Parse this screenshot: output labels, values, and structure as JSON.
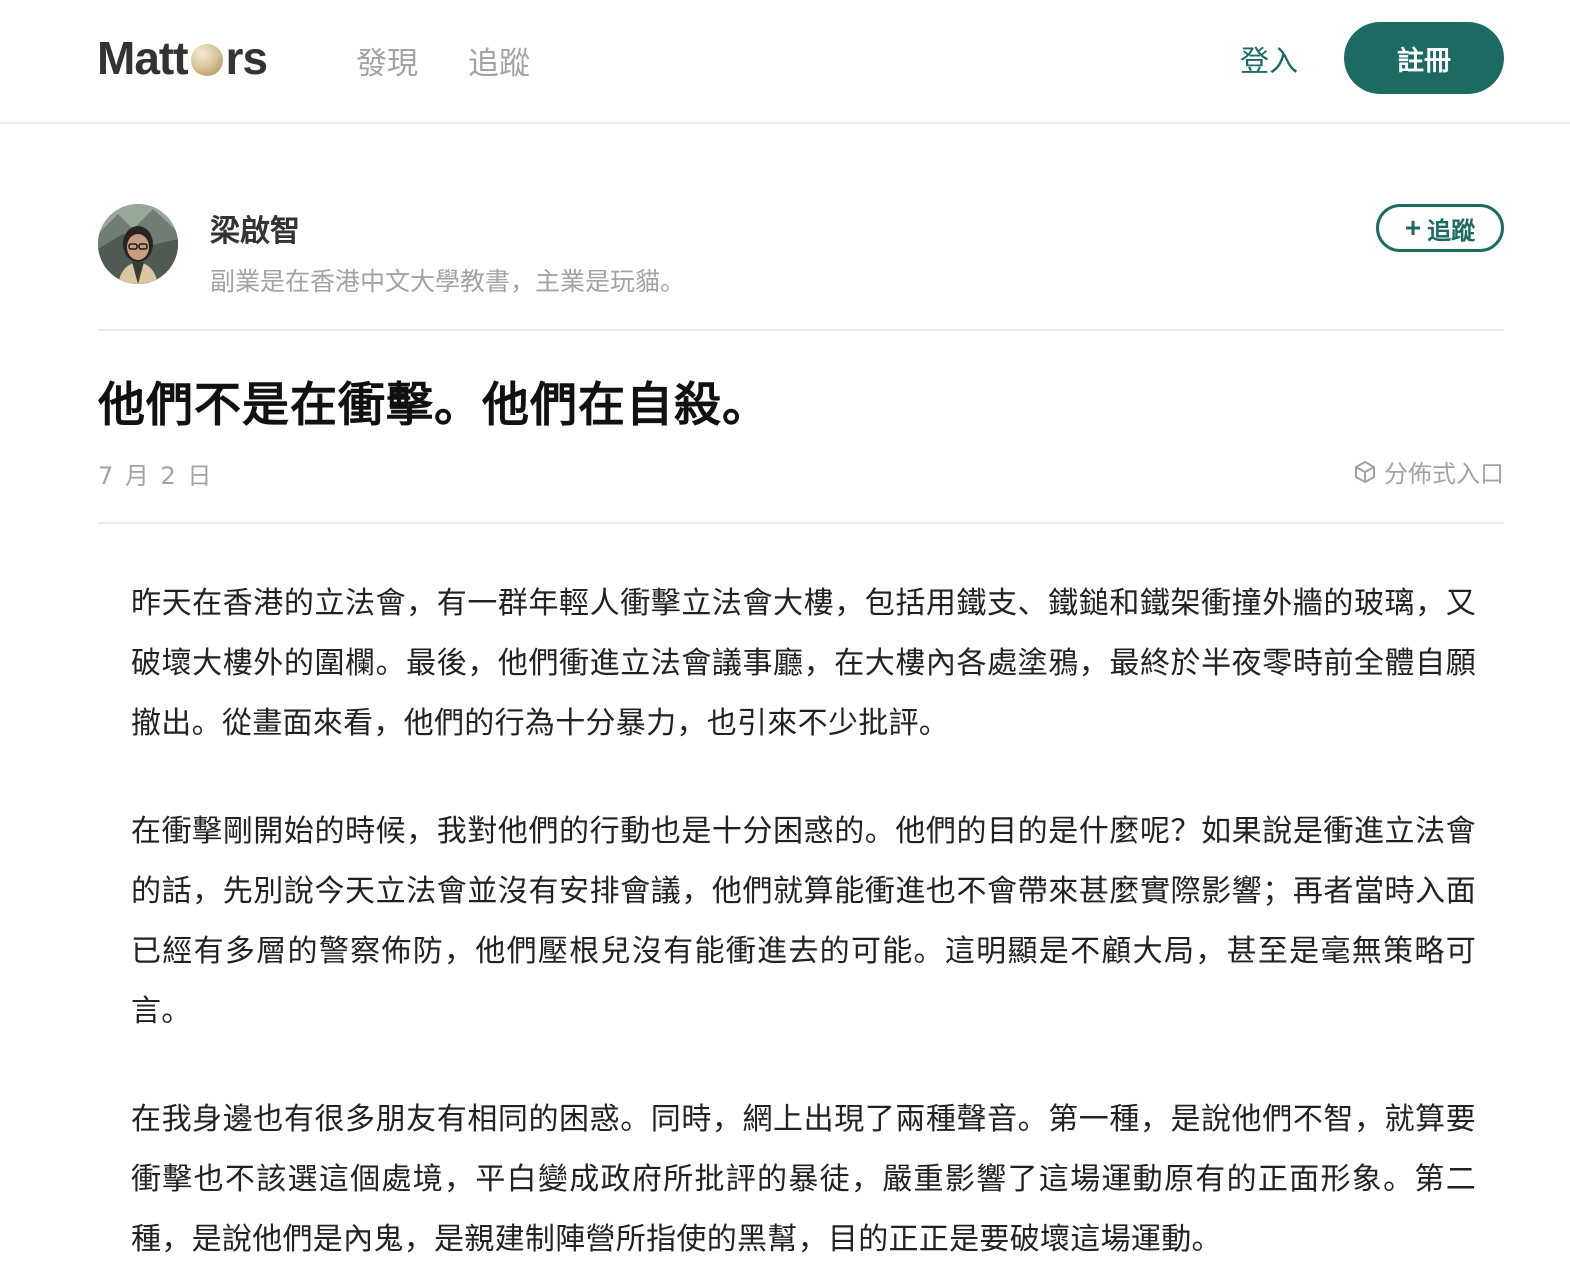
{
  "header": {
    "logo_text": "Matt rs",
    "logo_prefix": "Matt",
    "logo_suffix": "rs",
    "nav": [
      {
        "label": "發現"
      },
      {
        "label": "追蹤"
      }
    ],
    "login_label": "登入",
    "signup_label": "註冊"
  },
  "author": {
    "name": "梁啟智",
    "bio": "副業是在香港中文大學教書，主業是玩貓。",
    "follow_label": "追蹤",
    "follow_icon": "plus-icon"
  },
  "article": {
    "title": "他們不是在衝擊。他們在自殺。",
    "date": "7 月 2 日",
    "distributed_label": "分佈式入口",
    "distributed_icon": "cube-icon",
    "paragraphs": [
      "昨天在香港的立法會，有一群年輕人衝擊立法會大樓，包括用鐵支、鐵鎚和鐵架衝撞外牆的玻璃，又破壞大樓外的圍欄。最後，他們衝進立法會議事廳，在大樓內各處塗鴉，最終於半夜零時前全體自願撤出。從畫面來看，他們的行為十分暴力，也引來不少批評。",
      "在衝擊剛開始的時候，我對他們的行動也是十分困惑的。他們的目的是什麼呢？如果說是衝進立法會的話，先別說今天立法會並沒有安排會議，他們就算能衝進也不會帶來甚麼實際影響；再者當時入面已經有多層的警察佈防，他們壓根兒沒有能衝進去的可能。這明顯是不顧大局，甚至是毫無策略可言。",
      "在我身邊也有很多朋友有相同的困惑。同時，網上出現了兩種聲音。第一種，是說他們不智，就算要衝擊也不該選這個處境，平白變成政府所批評的暴徒，嚴重影響了這場運動原有的正面形象。第二種，是說他們是內鬼，是親建制陣營所指使的黑幫，目的正正是要破壞這場運動。"
    ]
  },
  "colors": {
    "brand": "#1b6b63",
    "muted": "#a3a3a3",
    "divider": "#ececec"
  }
}
